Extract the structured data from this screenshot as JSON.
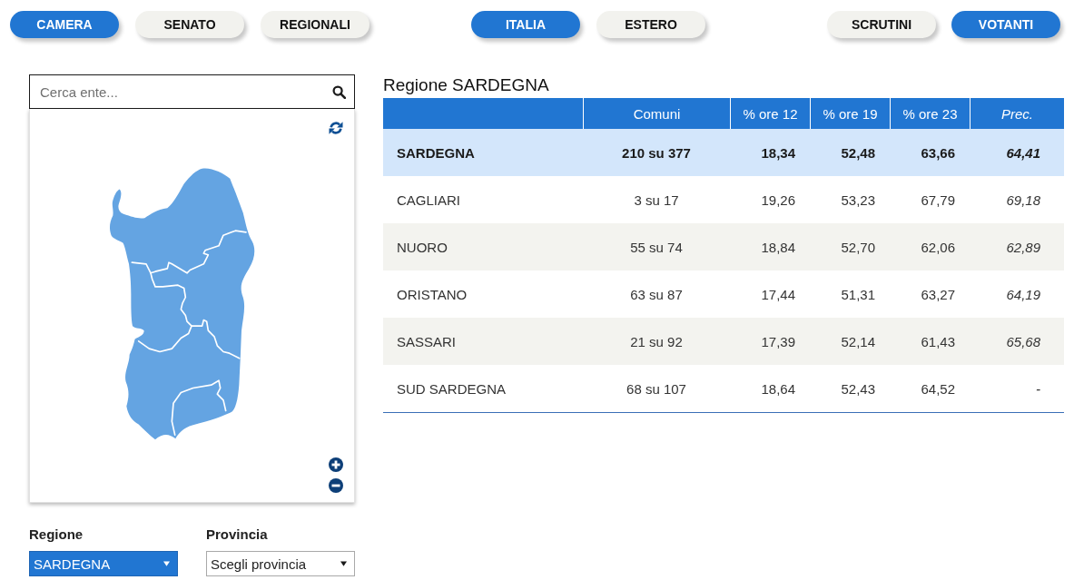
{
  "nav": {
    "election_tabs": [
      {
        "label": "CAMERA",
        "selected": true
      },
      {
        "label": "SENATO",
        "selected": false
      },
      {
        "label": "REGIONALI",
        "selected": false
      }
    ],
    "area_tabs": [
      {
        "label": "ITALIA",
        "selected": true
      },
      {
        "label": "ESTERO",
        "selected": false
      }
    ],
    "view_tabs": [
      {
        "label": "SCRUTINI",
        "selected": false
      },
      {
        "label": "VOTANTI",
        "selected": true
      }
    ]
  },
  "search": {
    "placeholder": "Cerca ente..."
  },
  "filters": [
    {
      "label": "Regione",
      "value": "SARDEGNA",
      "active": true
    },
    {
      "label": "Provincia",
      "value": "Scegli provincia",
      "active": false
    }
  ],
  "table": {
    "title": "Regione SARDEGNA",
    "columns": [
      "Comuni",
      "% ore 12",
      "% ore 19",
      "% ore 23",
      "Prec."
    ],
    "rows": [
      {
        "name": "SARDEGNA",
        "selected": true,
        "cells": [
          "210 su 377",
          "18,34",
          "52,48",
          "63,66",
          "64,41"
        ]
      },
      {
        "name": "CAGLIARI",
        "selected": false,
        "cells": [
          "3 su 17",
          "19,26",
          "53,23",
          "67,79",
          "69,18"
        ]
      },
      {
        "name": "NUORO",
        "selected": false,
        "cells": [
          "55 su 74",
          "18,84",
          "52,70",
          "62,06",
          "62,89"
        ]
      },
      {
        "name": "ORISTANO",
        "selected": false,
        "cells": [
          "63 su 87",
          "17,44",
          "51,31",
          "63,27",
          "64,19"
        ]
      },
      {
        "name": "SASSARI",
        "selected": false,
        "cells": [
          "21 su 92",
          "17,39",
          "52,14",
          "61,43",
          "65,68"
        ]
      },
      {
        "name": "SUD SARDEGNA",
        "selected": false,
        "cells": [
          "68 su 107",
          "18,64",
          "52,43",
          "64,52",
          "-"
        ]
      }
    ]
  }
}
